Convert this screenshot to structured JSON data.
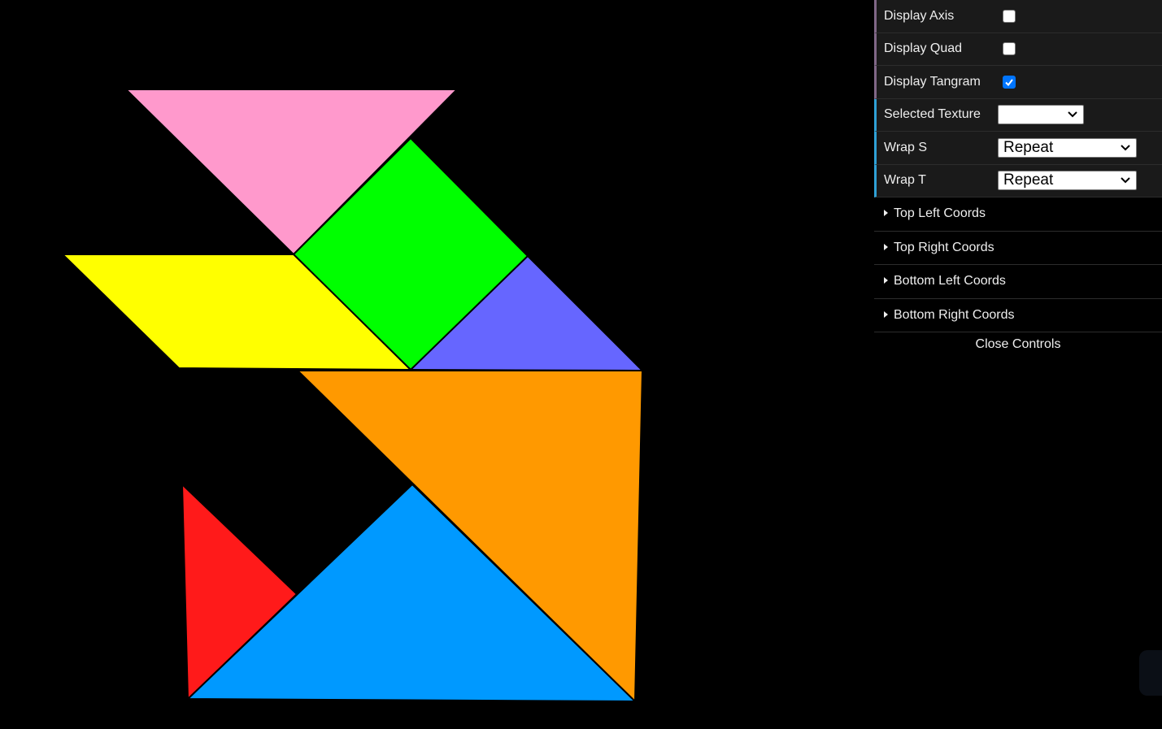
{
  "tangram": {
    "pieces": [
      {
        "name": "large-triangle-orange",
        "color": "#ff9900"
      },
      {
        "name": "large-triangle-blue",
        "color": "#0099ff"
      },
      {
        "name": "medium-triangle-pink",
        "color": "#ff99cc"
      },
      {
        "name": "square-green",
        "color": "#00ff00"
      },
      {
        "name": "parallelogram-yellow",
        "color": "#ffff00"
      },
      {
        "name": "small-triangle-purple",
        "color": "#6666ff"
      },
      {
        "name": "small-triangle-red",
        "color": "#ff1a1a"
      }
    ]
  },
  "controls": {
    "display_axis": {
      "label": "Display Axis",
      "checked": false
    },
    "display_quad": {
      "label": "Display Quad",
      "checked": false
    },
    "display_tangram": {
      "label": "Display Tangram",
      "checked": true
    },
    "selected_texture": {
      "label": "Selected Texture",
      "value": ""
    },
    "wrap_s": {
      "label": "Wrap S",
      "value": "Repeat"
    },
    "wrap_t": {
      "label": "Wrap T",
      "value": "Repeat"
    },
    "folders": [
      {
        "label": "Top Left Coords"
      },
      {
        "label": "Top Right Coords"
      },
      {
        "label": "Bottom Left Coords"
      },
      {
        "label": "Bottom Right Coords"
      }
    ],
    "close_label": "Close Controls"
  }
}
